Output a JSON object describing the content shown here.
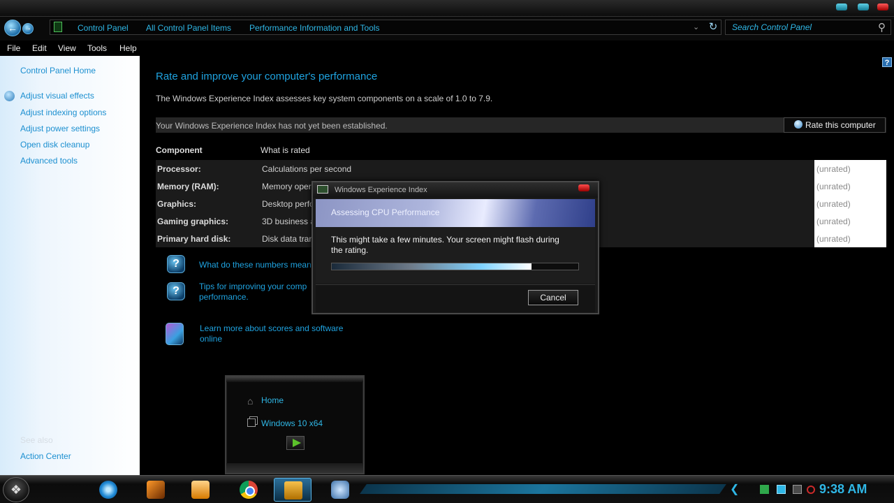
{
  "breadcrumbs": [
    "Control Panel",
    "All Control Panel Items",
    "Performance Information and Tools"
  ],
  "search": {
    "placeholder": "Search Control Panel"
  },
  "menu": [
    "File",
    "Edit",
    "View",
    "Tools",
    "Help"
  ],
  "sidebar": {
    "home": "Control Panel Home",
    "links": [
      "Adjust visual effects",
      "Adjust indexing options",
      "Adjust power settings",
      "Open disk cleanup",
      "Advanced tools"
    ],
    "see_also_heading": "See also",
    "see_also": [
      "Action Center"
    ]
  },
  "main": {
    "title": "Rate and improve your computer's performance",
    "description": "The Windows Experience Index assesses key system components on a scale of 1.0 to 7.9.",
    "status": "Your Windows Experience Index has not yet been established.",
    "rate_button": "Rate this computer",
    "columns": {
      "component": "Component",
      "what_is_rated": "What is rated"
    },
    "rows": [
      {
        "component": "Processor:",
        "rated": "Calculations per second",
        "score": "(unrated)"
      },
      {
        "component": "Memory (RAM):",
        "rated": "Memory oper",
        "score": "(unrated)"
      },
      {
        "component": "Graphics:",
        "rated": "Desktop perfo",
        "score": "(unrated)"
      },
      {
        "component": "Gaming graphics:",
        "rated": "3D business a",
        "score": "(unrated)"
      },
      {
        "component": "Primary hard disk:",
        "rated": "Disk data trar",
        "score": "(unrated)"
      }
    ],
    "links": [
      {
        "text": "What do these numbers mean"
      },
      {
        "line1": "Tips for improving your comp",
        "line2": "performance."
      },
      {
        "line1": "Learn more about scores and software",
        "line2": "online"
      }
    ]
  },
  "mini_panel": {
    "home": "Home",
    "windows": "Windows 10 x64"
  },
  "dialog": {
    "title": "Windows Experience Index",
    "heading": "Assessing CPU Performance",
    "message": "This might take a few minutes. Your screen might flash during the rating.",
    "progress": 0.81,
    "cancel": "Cancel"
  },
  "taskbar": {
    "apps": [
      "internet-explorer-icon",
      "media-center-icon",
      "media-player-icon",
      "chrome-icon",
      "explorer-icon",
      "control-panel-icon"
    ],
    "time": "9:38 AM"
  },
  "colors": {
    "accent": "#1fa3e0",
    "link": "#1b8fd0",
    "background": "#000000",
    "sidebar": "#eef6fd"
  }
}
